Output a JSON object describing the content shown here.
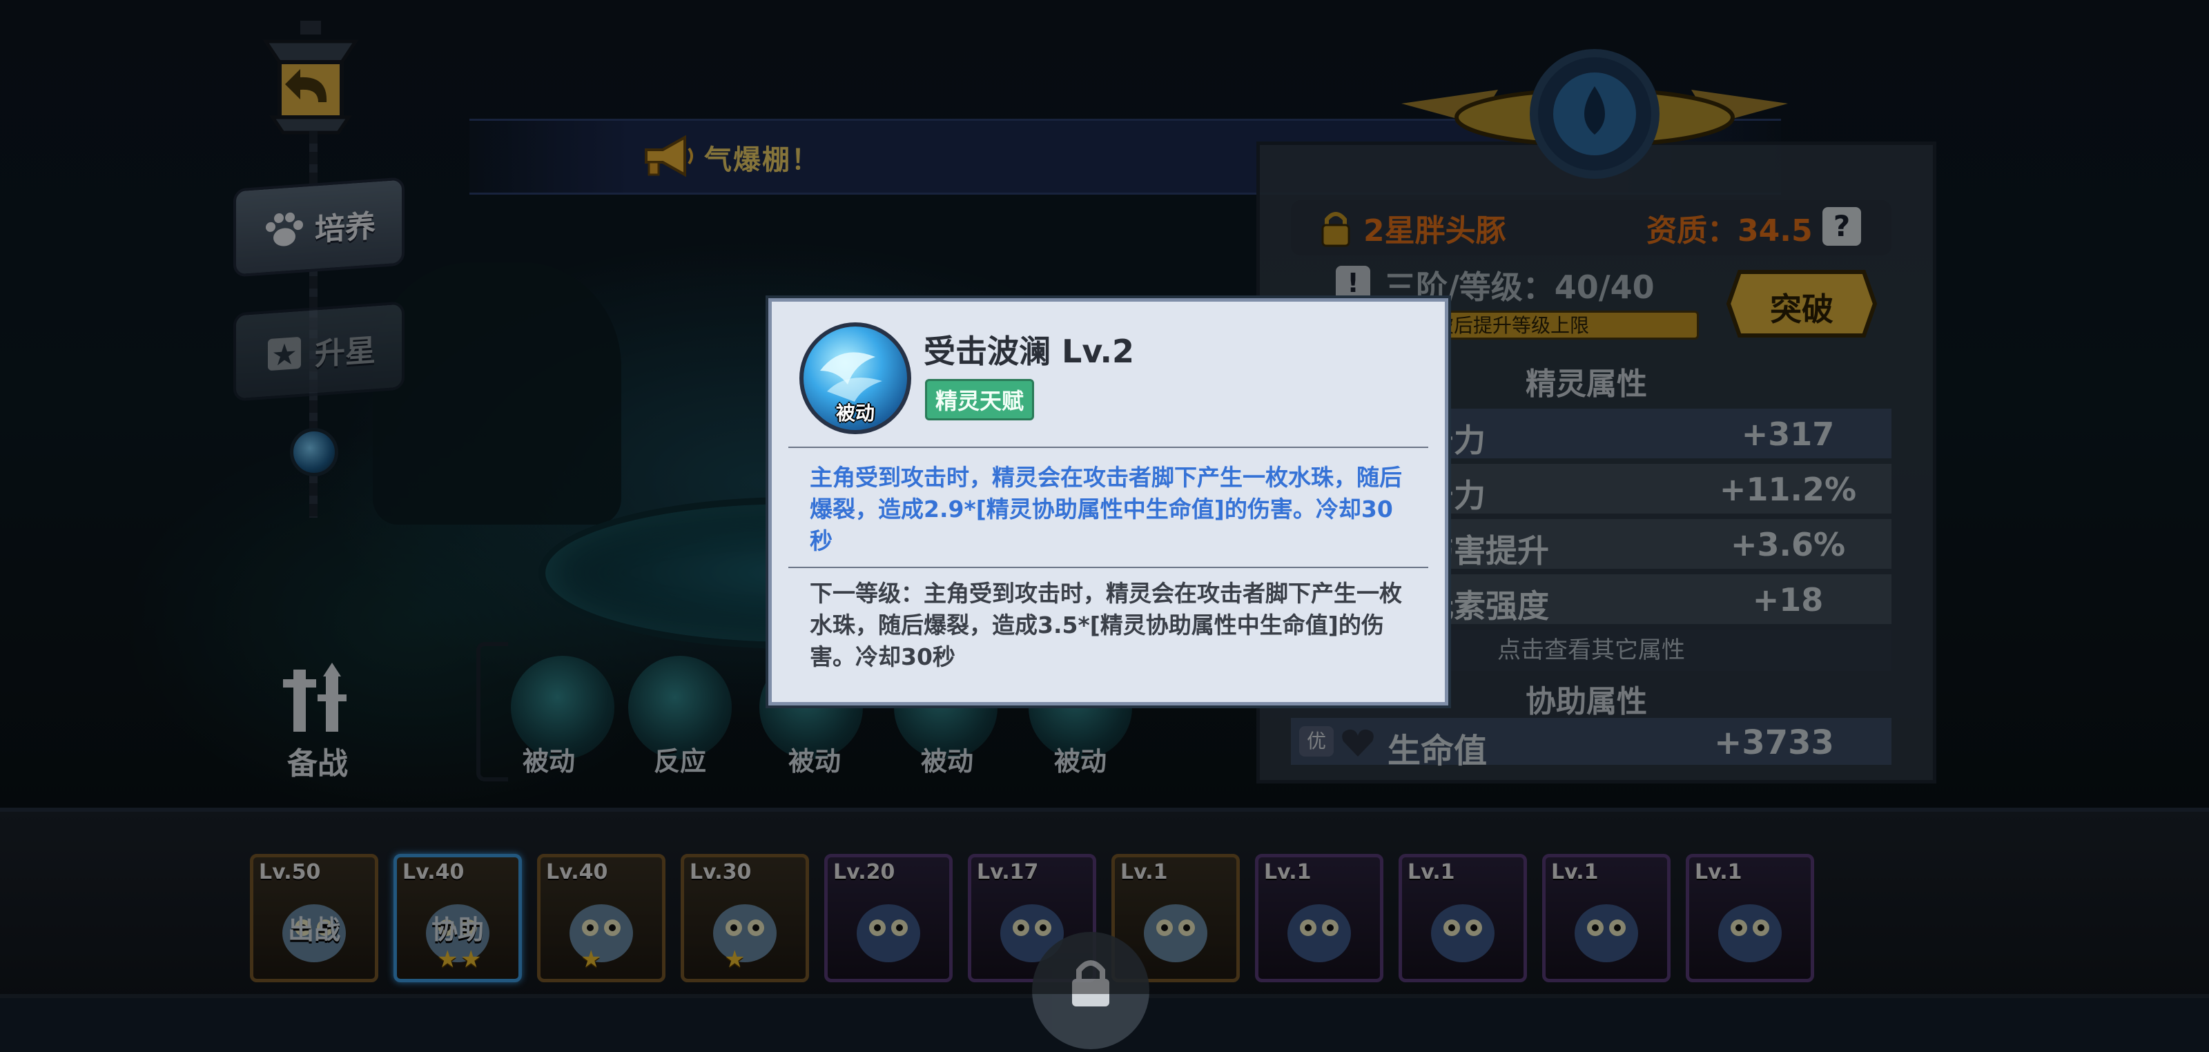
{
  "announcement": {
    "text": "气爆棚！"
  },
  "side_menu": {
    "peiyang": "培养",
    "shengxing": "升星",
    "beizhan": "备战"
  },
  "skill_slots": [
    "被动",
    "反应",
    "被动",
    "被动",
    "被动"
  ],
  "sprite_info": {
    "name": "2星胖头豚",
    "quality": "资质：34.5",
    "quality_help": "?",
    "stage_level": "三阶/等级：40/40",
    "breakthrough_hint": "突破后提升等级上限",
    "breakthrough_button": "突破"
  },
  "sprite_attributes": {
    "title": "精灵属性",
    "rows": [
      {
        "name": "击力",
        "value": "+317"
      },
      {
        "name": "击力",
        "value": "+11.2%"
      },
      {
        "name": "伤害提升",
        "value": "+3.6%"
      },
      {
        "name": "元素强度",
        "value": "+18"
      }
    ],
    "more": "点击查看其它属性"
  },
  "assist_attributes": {
    "title": "协助属性",
    "badge": "优",
    "hp_name": "生命值",
    "hp_value": "+3733"
  },
  "tooltip": {
    "skill_name": "受击波澜 Lv.2",
    "type": "被动",
    "tag": "精灵天赋",
    "description": "主角受到攻击时，精灵会在攻击者脚下产生一枚水珠，随后爆裂，造成2.9*[精灵协助属性中生命值]的伤害。冷却30秒",
    "next_level": "下一等级：主角受到攻击时，精灵会在攻击者脚下产生一枚水珠，随后爆裂，造成3.5*[精灵协助属性中生命值]的伤害。冷却30秒"
  },
  "sprite_cards": [
    {
      "level": "Lv.50",
      "status": "出战",
      "stars": 0,
      "frame": "gold"
    },
    {
      "level": "Lv.40",
      "status": "协助",
      "stars": 2,
      "frame": "selected"
    },
    {
      "level": "Lv.40",
      "status": "",
      "stars": 1,
      "frame": "gold"
    },
    {
      "level": "Lv.30",
      "status": "",
      "stars": 1,
      "frame": "gold"
    },
    {
      "level": "Lv.20",
      "status": "",
      "stars": 0,
      "frame": "purple"
    },
    {
      "level": "Lv.17",
      "status": "",
      "stars": 0,
      "frame": "purple"
    },
    {
      "level": "Lv.1",
      "status": "",
      "stars": 0,
      "frame": "gold"
    },
    {
      "level": "Lv.1",
      "status": "",
      "stars": 0,
      "frame": "purple"
    },
    {
      "level": "Lv.1",
      "status": "",
      "stars": 0,
      "frame": "purple"
    },
    {
      "level": "Lv.1",
      "status": "",
      "stars": 0,
      "frame": "purple"
    },
    {
      "level": "Lv.1",
      "status": "",
      "stars": 0,
      "frame": "purple"
    }
  ],
  "colors": {
    "accent_orange": "#e8731a",
    "tooltip_text_blue": "#3572d6",
    "tag_green": "#3daf7e",
    "gold_button": "#e2b53c"
  }
}
